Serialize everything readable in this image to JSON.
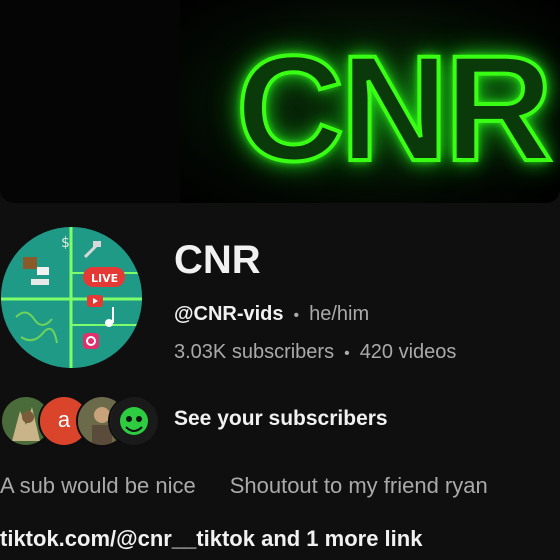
{
  "banner": {
    "text": "CNR",
    "glow_color": "#39ff14"
  },
  "channel": {
    "name": "CNR",
    "handle": "@CNR-vids",
    "pronouns": "he/him",
    "subscribers": "3.03K subscribers",
    "videos": "420 videos",
    "separator": "•"
  },
  "avatar": {
    "live_badge": "LIVE",
    "background_color": "#1f9a86"
  },
  "subscribers_row": {
    "see_label": "See your subscribers",
    "avatar_letter": "a",
    "letter_avatar_color": "#d9442b"
  },
  "description": {
    "part1": "A sub would be nice",
    "part2": "Shoutout to my friend ryan"
  },
  "links": {
    "text": "tiktok.com/@cnr__tiktok and 1 more link"
  },
  "icons": [
    "dollar-icon",
    "hammer-icon",
    "play-icon",
    "music-note-icon",
    "instagram-icon",
    "live-badge-icon"
  ]
}
